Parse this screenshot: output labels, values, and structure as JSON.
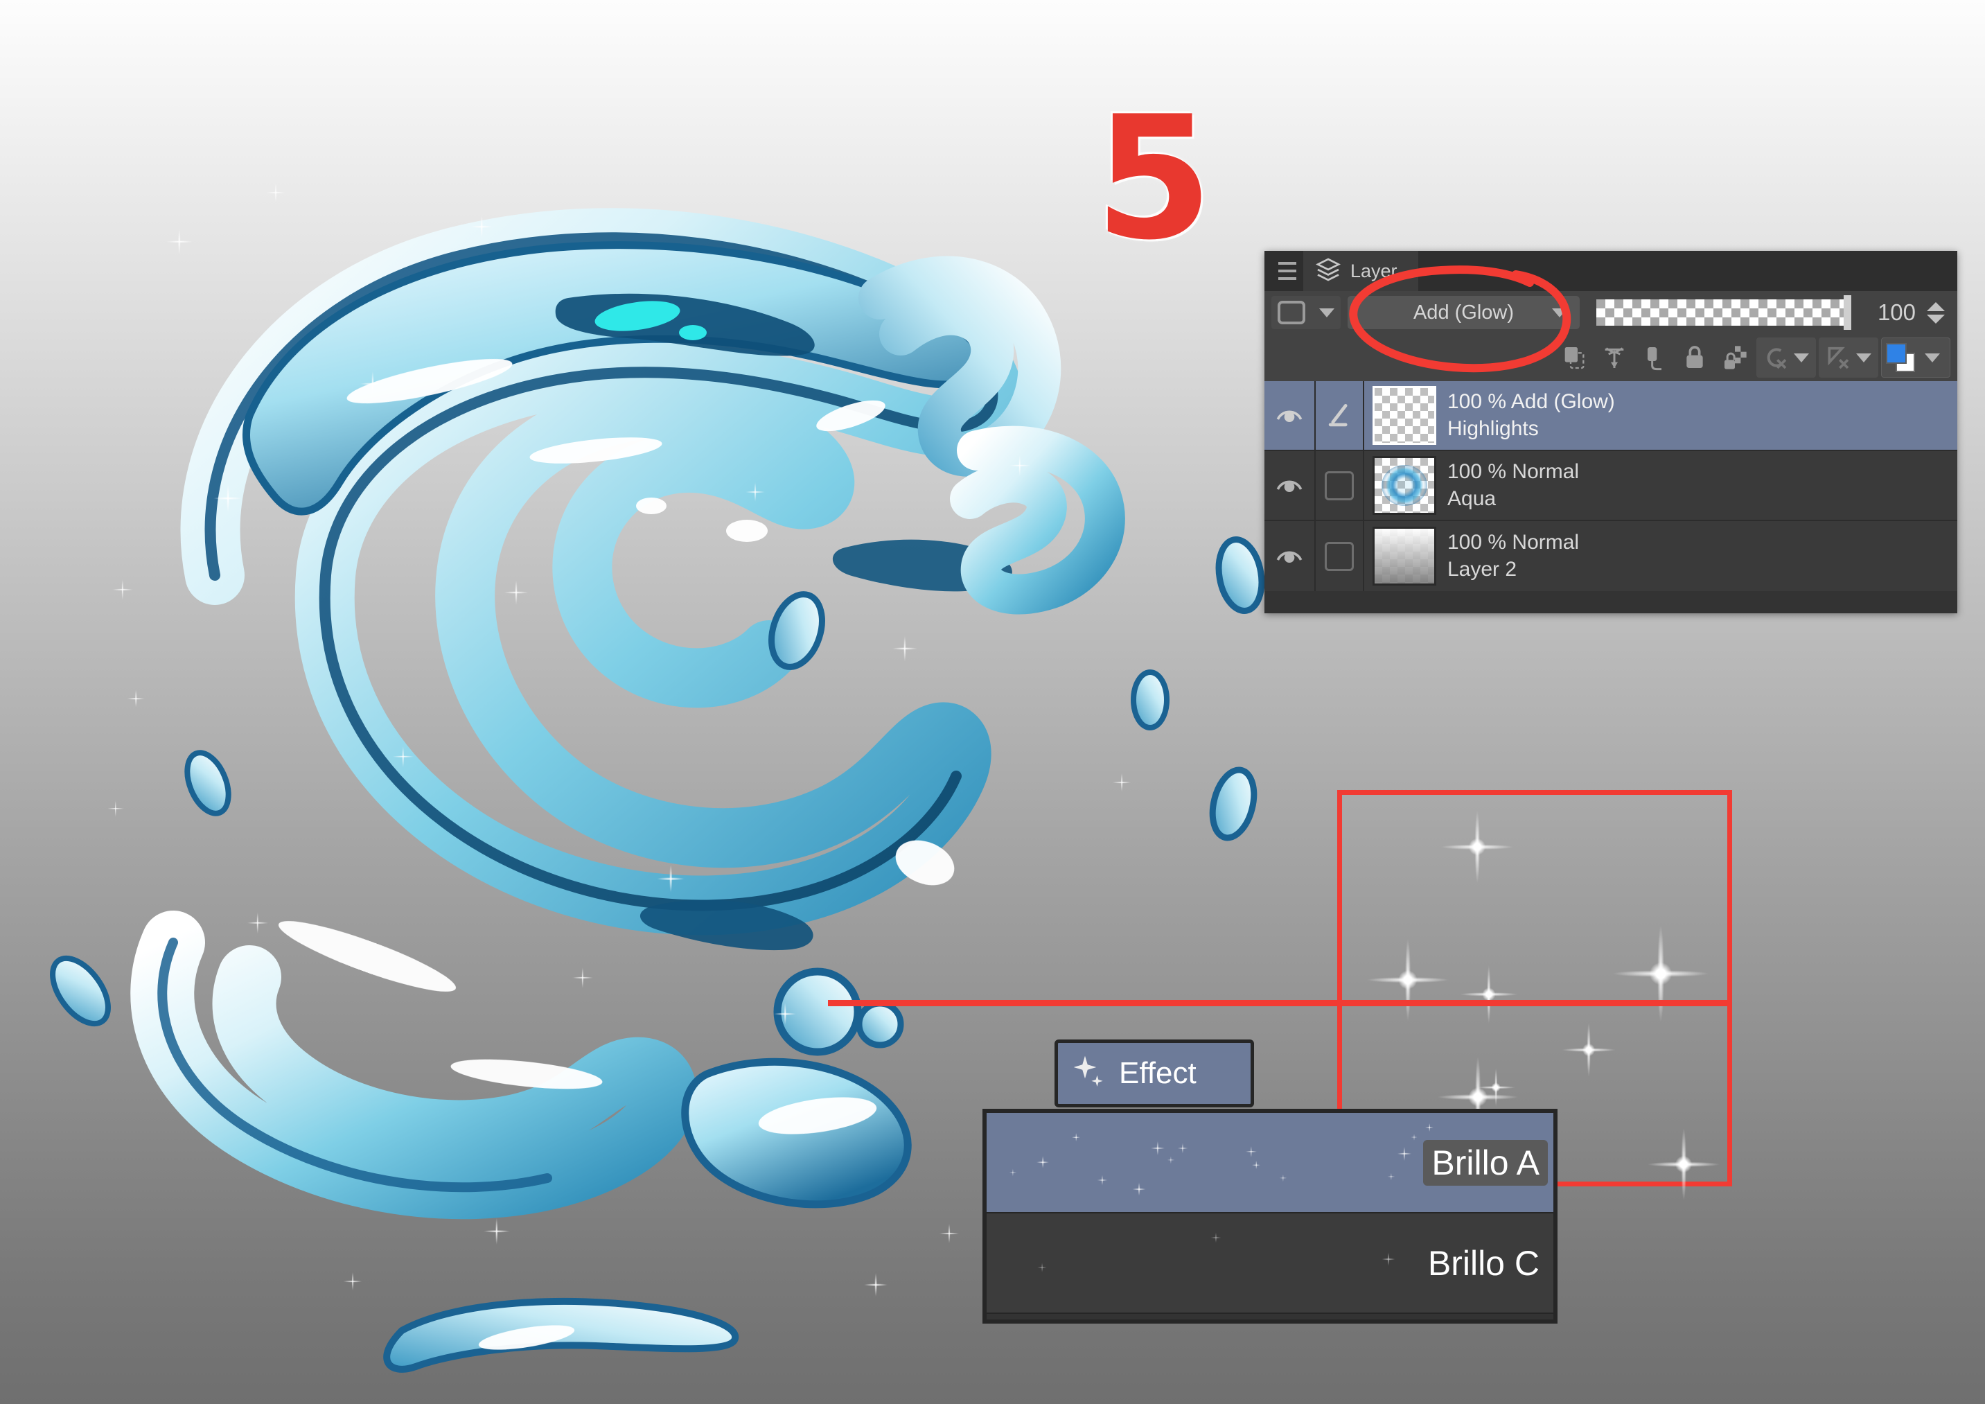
{
  "annotation": {
    "step_number": "5",
    "accent_color": "#f23b33"
  },
  "artwork": {
    "title": "water-splash-illustration",
    "palette": {
      "deep_blue": "#0d4f7a",
      "mid_blue": "#3e9fc4",
      "light_blue": "#9fdcee",
      "pale": "#dff2f8",
      "white": "#ffffff",
      "cyan_accent": "#2fe8e8"
    },
    "background_gradient": {
      "top": "#fdfdfd",
      "bottom": "#6f6f6f"
    }
  },
  "layer_panel": {
    "menu_icon": "hamburger-menu-icon",
    "tab_icon": "layers-stack-icon",
    "tab_label": "Layer",
    "blend_mode_selected": "Add (Glow)",
    "opacity_value": "100",
    "toolbar_icons": [
      "clip-to-layer-below-icon",
      "reference-layer-icon",
      "draft-layer-icon",
      "lock-layer-icon",
      "lock-transparent-pixels-icon",
      "layer-mask-icon",
      "ruler-mask-icon",
      "layer-color-icon"
    ],
    "rows": [
      {
        "visible": true,
        "mode": "100 % Add (Glow)",
        "name": "Highlights",
        "selected": true,
        "thumb": "checker",
        "has_pen": true
      },
      {
        "visible": true,
        "mode": "100 % Normal",
        "name": "Aqua",
        "selected": false,
        "thumb": "aqua",
        "has_pen": false
      },
      {
        "visible": true,
        "mode": "100 % Normal",
        "name": "Layer 2",
        "selected": false,
        "thumb": "gradient",
        "has_pen": false
      }
    ]
  },
  "brush_panel": {
    "effect_tab_label": "Effect",
    "effect_tab_icon": "sparkle-icon",
    "brushes": [
      {
        "name": "Brillo A",
        "selected": true
      },
      {
        "name": "Brillo C",
        "selected": false
      }
    ]
  },
  "zoom_preview": {
    "label": "sparkle-brush-zoom-preview",
    "border_color": "#f23b33"
  }
}
